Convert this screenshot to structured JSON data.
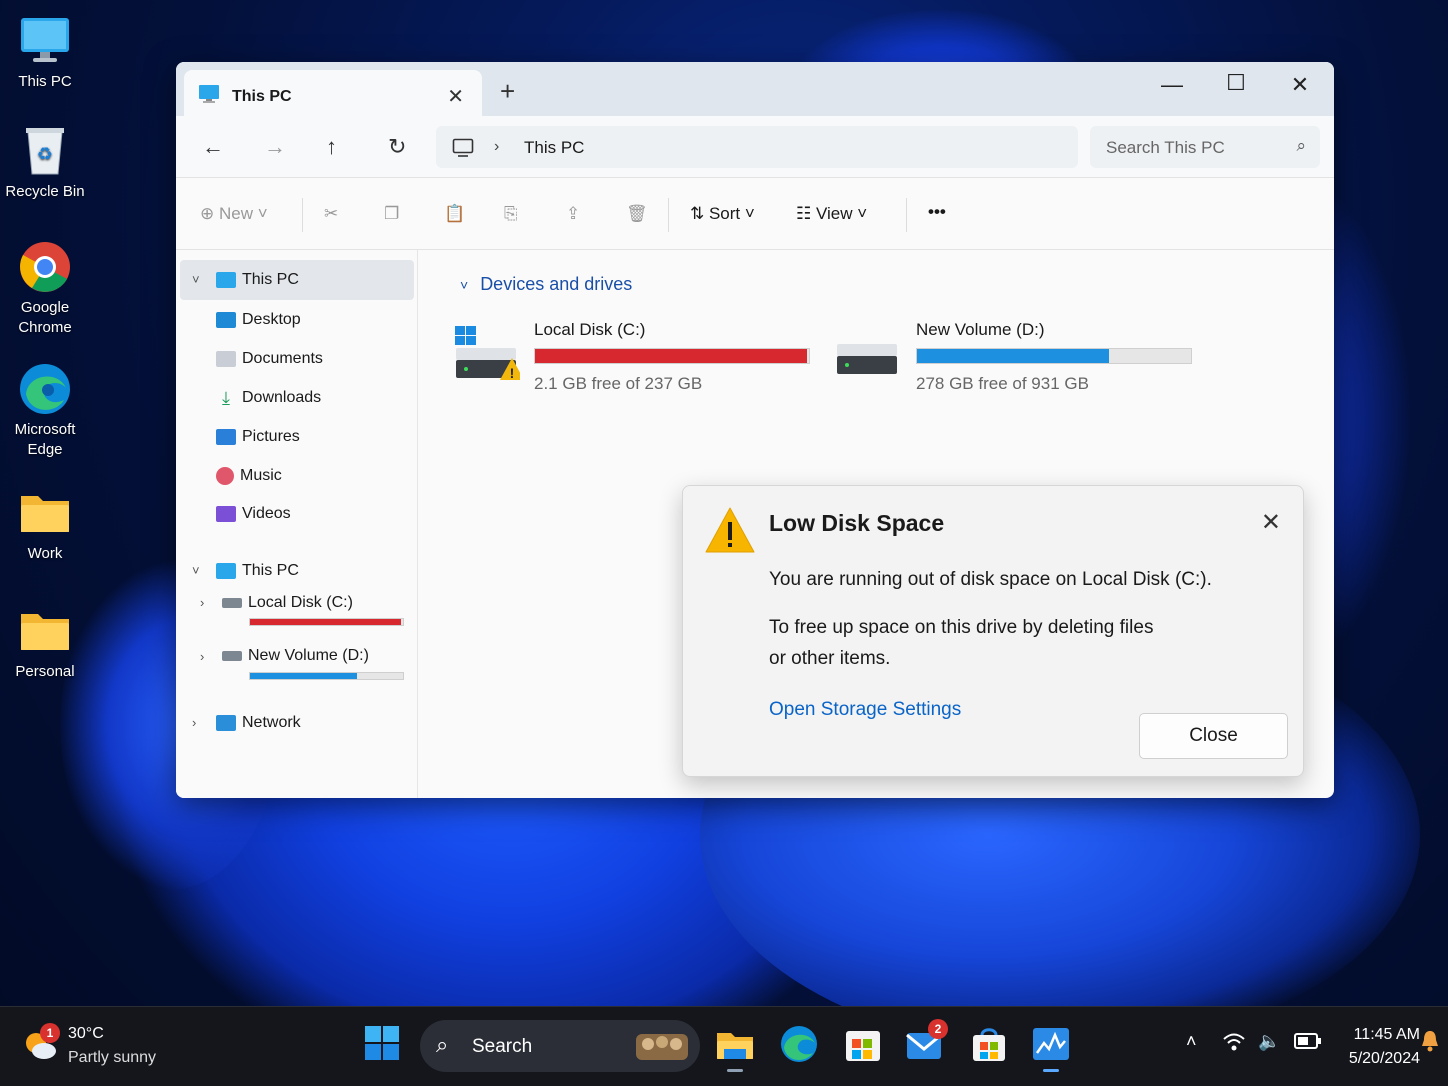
{
  "desktop": {
    "icons": [
      {
        "label": "This PC"
      },
      {
        "label": "Recycle Bin"
      },
      {
        "label": "Google Chrome"
      },
      {
        "label": "Microsoft Edge"
      },
      {
        "label": "Work"
      },
      {
        "label": "Personal"
      }
    ]
  },
  "window": {
    "tab_title": "This PC",
    "new_tab": "+",
    "address": "This PC",
    "search_placeholder": "Search This PC",
    "toolbar": {
      "new_label": "New",
      "sort_label": "Sort",
      "view_label": "View",
      "more_label": "•••"
    },
    "nav": {
      "items": [
        {
          "label": "This PC",
          "icon": "monitor-icon"
        },
        {
          "label": "Desktop",
          "icon": "desktop-folder-icon"
        },
        {
          "label": "Documents",
          "icon": "documents-icon"
        },
        {
          "label": "Downloads",
          "icon": "download-icon"
        },
        {
          "label": "Pictures",
          "icon": "pictures-icon"
        },
        {
          "label": "Music",
          "icon": "music-icon"
        },
        {
          "label": "Videos",
          "icon": "videos-icon"
        }
      ],
      "tree": {
        "root": "This PC",
        "drive_c": "Local Disk (C:)",
        "drive_d": "New Volume (D:)",
        "network": "Network"
      }
    },
    "content": {
      "section": "Devices and drives",
      "drives": [
        {
          "name": "Local Disk (C:)",
          "free_text": "2.1 GB free of 237 GB",
          "used_fraction": 0.991,
          "bar_color": "#d6282e",
          "warning": true
        },
        {
          "name": "New Volume (D:)",
          "free_text": "278 GB free of 931 GB",
          "used_fraction": 0.701,
          "bar_color": "#1e90e0",
          "warning": false
        }
      ]
    }
  },
  "dialog": {
    "title": "Low Disk Space",
    "message": "You are running out of disk space on Local Disk (C:).",
    "detail": "To free up space on this drive by deleting files or other items.",
    "link": "Open Storage Settings",
    "close_button": "Close",
    "icon": "warning-icon"
  },
  "taskbar": {
    "weather_temp": "30°C",
    "weather_desc": "Partly sunny",
    "weather_badge": "1",
    "search_label": "Search",
    "mail_badge": "2",
    "time": "11:45 AM",
    "date": "5/20/2024"
  }
}
